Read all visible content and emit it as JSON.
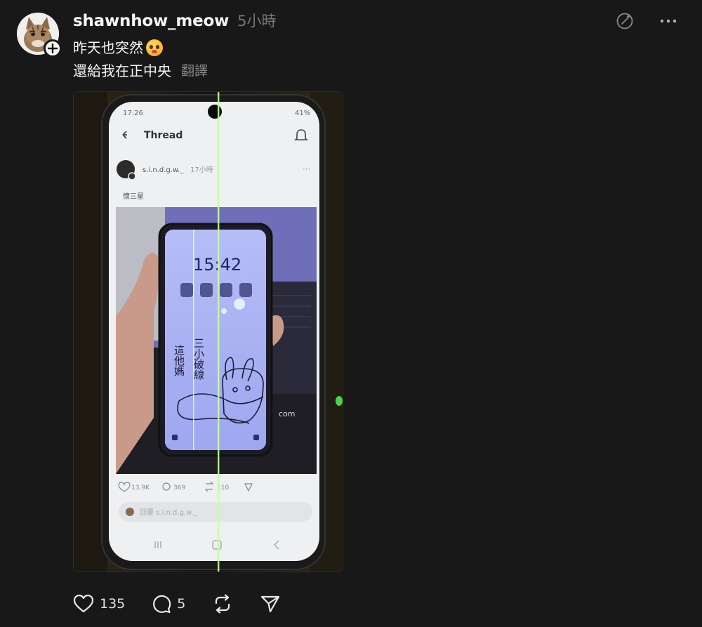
{
  "post": {
    "username": "shawnhow_meow",
    "time": "5小時",
    "text_line1": "昨天也突然",
    "text_line2": "還給我在正中央",
    "translate": "翻譯"
  },
  "photo": {
    "status_time": "17:26",
    "status_right": "41%",
    "header_title": "Thread",
    "inner_username": "s.i.n.d.g.w._",
    "inner_time": "17小時",
    "inner_text": "懷三星",
    "lock_time": "15:42",
    "wallpaper_text_left": "這他媽",
    "wallpaper_text_right": "三小破線",
    "likes": "13.9K",
    "replies": "369",
    "reposts": "110",
    "reply_placeholder": "回覆 s.i.n.d.g.w._",
    "brand_partial": "com"
  },
  "actions": {
    "likes": "135",
    "replies": "5"
  },
  "colors": {
    "background": "#181818",
    "text": "#f3f5f7",
    "muted": "#777777",
    "green_line": "#c8ff9a"
  }
}
